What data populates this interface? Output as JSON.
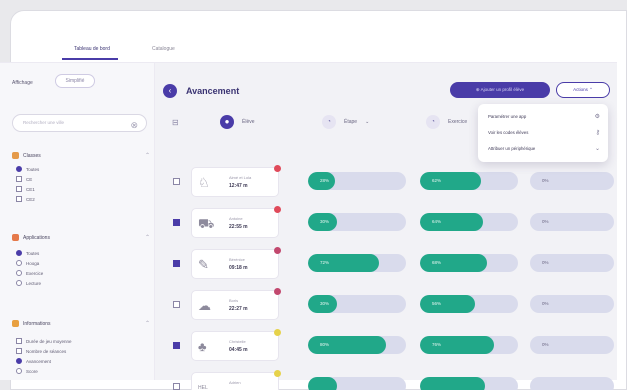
{
  "tabs": [
    {
      "label": "Tableau de bord",
      "active": true
    },
    {
      "label": "Catalogue",
      "active": false
    }
  ],
  "sidebar": {
    "display_label": "Affichage",
    "display_value": "Simplifié",
    "search_placeholder": "Rechercher une ville",
    "sections": [
      {
        "title": "Classes",
        "color": "#e59a4a",
        "type": "radio",
        "options": [
          {
            "label": "Toutes",
            "checked": true
          },
          {
            "label": "CE",
            "checked": false
          },
          {
            "label": "CE1",
            "checked": false
          },
          {
            "label": "CE2",
            "checked": false
          }
        ]
      },
      {
        "title": "Applications",
        "color": "#e5794a",
        "type": "radio",
        "options": [
          {
            "label": "Toutes",
            "checked": true
          },
          {
            "label": "Hooga",
            "checked": false
          },
          {
            "label": "Exercice",
            "checked": false
          },
          {
            "label": "Lecture",
            "checked": false
          }
        ]
      },
      {
        "title": "Informations",
        "color": "#e8a040",
        "type": "mixed",
        "options": [
          {
            "label": "Durée de jeu moyenne",
            "checked": false,
            "kind": "check"
          },
          {
            "label": "Nombre de séances",
            "checked": false,
            "kind": "check"
          },
          {
            "label": "Avancement",
            "checked": true,
            "kind": "radio"
          },
          {
            "label": "Score",
            "checked": false,
            "kind": "radio"
          }
        ]
      }
    ]
  },
  "main": {
    "title": "Avancement",
    "primary_button": "Ajouter un profil élève",
    "secondary_button": "Actions",
    "columns": [
      {
        "label": "Élève"
      },
      {
        "label": "Étape"
      },
      {
        "label": "Exercice"
      }
    ],
    "rows": [
      {
        "label": "Aimé et Lola",
        "value": "12:47 m",
        "flag": "#e04a5a",
        "checked": false,
        "icon": "stroller-icon",
        "bars": [
          {
            "pct": 0.28,
            "label": "28%"
          },
          {
            "pct": 0.62,
            "label": "62%"
          },
          {
            "pct": 0,
            "label": "0%"
          }
        ]
      },
      {
        "label": "Antoine",
        "value": "22:55 m",
        "flag": "#e04a5a",
        "checked": true,
        "icon": "bus-icon",
        "bars": [
          {
            "pct": 0.3,
            "label": "30%"
          },
          {
            "pct": 0.64,
            "label": "64%"
          },
          {
            "pct": 0,
            "label": "0%"
          }
        ]
      },
      {
        "label": "Bérénice",
        "value": "09:18 m",
        "flag": "#c2486e",
        "checked": true,
        "icon": "pencil-icon",
        "bars": [
          {
            "pct": 0.72,
            "label": "72%"
          },
          {
            "pct": 0.68,
            "label": "68%"
          },
          {
            "pct": 0,
            "label": "0%"
          }
        ]
      },
      {
        "label": "Boris",
        "value": "22:27 m",
        "flag": "#c2486e",
        "checked": false,
        "icon": "hat-icon",
        "bars": [
          {
            "pct": 0.3,
            "label": "30%"
          },
          {
            "pct": 0.56,
            "label": "56%"
          },
          {
            "pct": 0,
            "label": "0%"
          }
        ]
      },
      {
        "label": "Christelle",
        "value": "04:45 m",
        "flag": "#e6d24a",
        "checked": true,
        "icon": "plant-icon",
        "bars": [
          {
            "pct": 0.8,
            "label": "80%"
          },
          {
            "pct": 0.76,
            "label": "76%"
          },
          {
            "pct": 0,
            "label": "0%"
          }
        ]
      },
      {
        "label": "Adrien",
        "value": "",
        "flag": "#e6d24a",
        "checked": false,
        "icon": "hello-icon",
        "thumb_text": "HEL",
        "bars": [
          {
            "pct": 0.3,
            "label": ""
          },
          {
            "pct": 0.66,
            "label": ""
          },
          {
            "pct": 0,
            "label": ""
          }
        ]
      }
    ]
  },
  "dropdown": {
    "items": [
      {
        "label": "Paramétrer une app",
        "icon": "gear-icon"
      },
      {
        "label": "Voir les codes élèves",
        "icon": "key-icon"
      },
      {
        "label": "Attribuer un périphérique",
        "icon": "chevron-down-icon"
      }
    ]
  },
  "colors": {
    "accent": "#4a3ca8",
    "progress": "#21a889",
    "track": "#d9dbec"
  }
}
